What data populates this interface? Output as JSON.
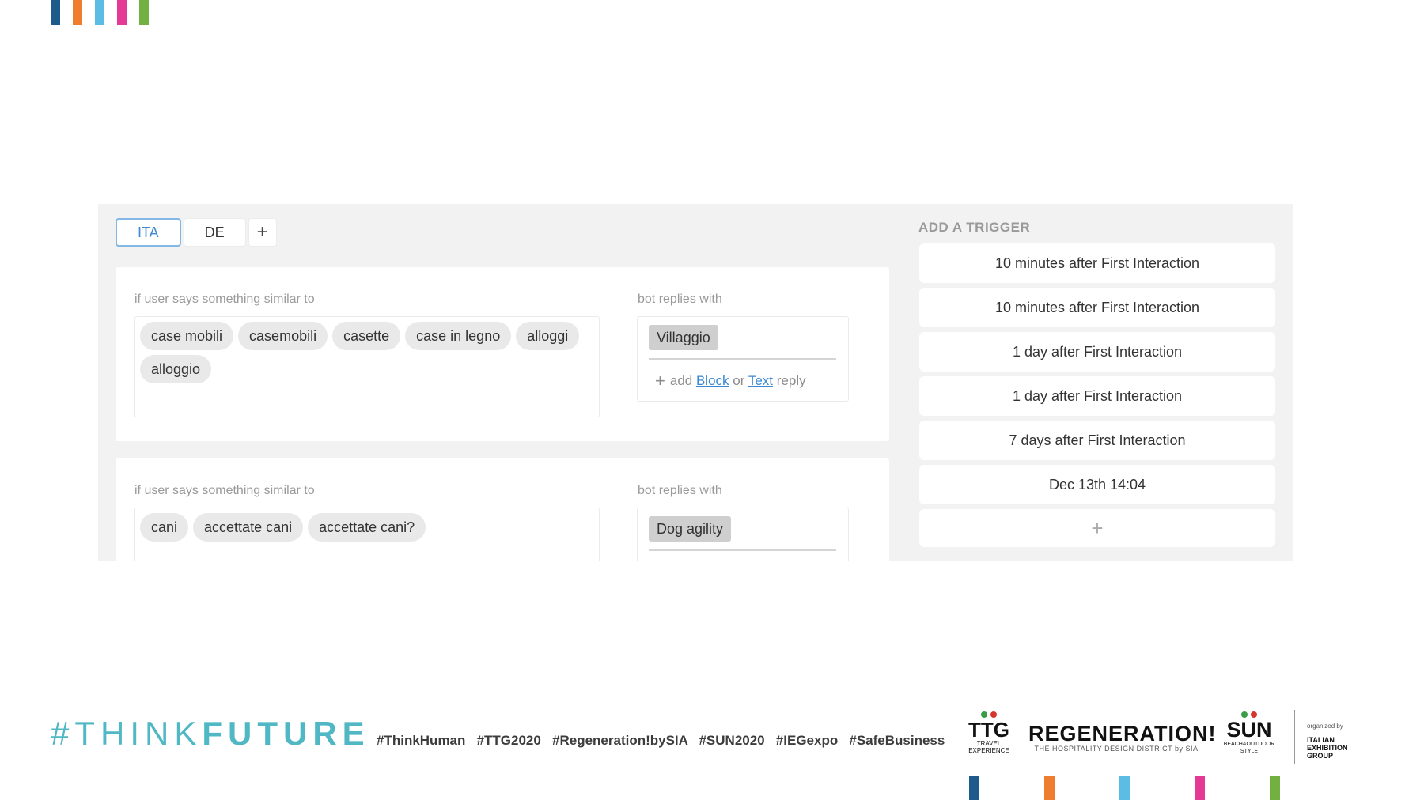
{
  "brand_colors": [
    "#1f5a8c",
    "#ef7d2f",
    "#5cbde4",
    "#e53996",
    "#72b042"
  ],
  "tabs": [
    {
      "label": "ITA",
      "active": true
    },
    {
      "label": "DE",
      "active": false
    },
    {
      "label": "+",
      "active": false
    }
  ],
  "rules": [
    {
      "caption_left": "if user says something similar to",
      "caption_right": "bot replies with",
      "phrases": [
        "case mobili",
        "casemobili",
        "casette",
        "case in legno",
        "alloggi",
        "alloggio"
      ],
      "reply": "Villaggio",
      "add_reply": {
        "plus": "+",
        "prefix": "add",
        "block": "Block",
        "middle": "or",
        "text": "Text",
        "suffix": "reply"
      }
    },
    {
      "caption_left": "if user says something similar to",
      "caption_right": "bot replies with",
      "phrases": [
        "cani",
        "accettate cani",
        "accettate cani?"
      ],
      "reply": "Dog agility"
    }
  ],
  "triggers": {
    "title": "ADD A TRIGGER",
    "items": [
      "10 minutes after First Interaction",
      "10 minutes after First Interaction",
      "1 day after First Interaction",
      "1 day after First Interaction",
      "7 days after First Interaction",
      "Dec 13th 14:04"
    ],
    "add_label": "+"
  },
  "footer": {
    "tag_prefix": "#THINK",
    "tag_bold": "FUTURE",
    "hashtags": "#ThinkHuman   #TTG2020   #Regeneration!bySIA   #SUN2020   #IEGexpo   #SafeBusiness",
    "logos": {
      "ttg": {
        "big": "TTG",
        "small": "TRAVEL EXPERIENCE"
      },
      "regeneration": {
        "big": "REGENERATION!",
        "small": "THE HOSPITALITY DESIGN DISTRICT by SIA"
      },
      "sun": {
        "big": "SUN",
        "small": "BEACH&OUTDOOR STYLE"
      },
      "ieg": {
        "small": "organized by",
        "big": "ITALIAN EXHIBITION GROUP"
      }
    }
  }
}
